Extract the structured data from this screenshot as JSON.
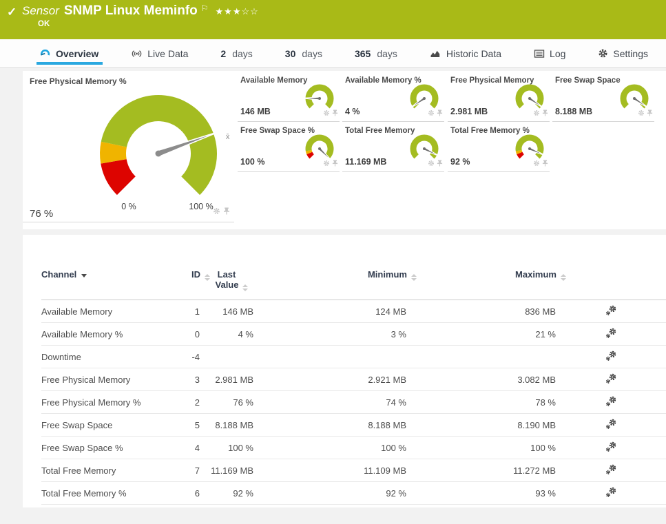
{
  "header": {
    "check_icon": "✓",
    "kind_label": "Sensor",
    "title": "SNMP Linux Meminfo",
    "flag_icon": "⚐",
    "stars_filled": "★★★",
    "stars_empty": "☆☆",
    "status": "OK",
    "bg_color": "#a9ba17"
  },
  "tabs": [
    {
      "label": "Overview",
      "icon": "gauge",
      "active": true
    },
    {
      "label": "Live Data",
      "icon": "live",
      "active": false
    },
    {
      "num": "2",
      "word": "days",
      "active": false
    },
    {
      "num": "30",
      "word": "days",
      "active": false
    },
    {
      "num": "365",
      "word": "days",
      "active": false
    },
    {
      "label": "Historic Data",
      "icon": "chart",
      "active": false
    },
    {
      "label": "Log",
      "icon": "log",
      "active": false
    },
    {
      "label": "Settings",
      "icon": "gear",
      "active": false
    }
  ],
  "gauges": {
    "main": {
      "title": "Free Physical Memory %",
      "value": "76 %",
      "min_label": "0 %",
      "max_label": "100 %",
      "needle_percent": 76,
      "avg_percent": 78,
      "avg_label": "x̄",
      "segments": [
        {
          "from": 0,
          "to": 13,
          "color": "#dd0400"
        },
        {
          "from": 13,
          "to": 21,
          "color": "#f0b400"
        },
        {
          "from": 21,
          "to": 100,
          "color": "#a4bc21"
        }
      ]
    },
    "segments_limits": [
      {
        "from": 0,
        "to": 8,
        "color": "#dd0400"
      },
      {
        "from": 8,
        "to": 13,
        "color": "#f0b400"
      },
      {
        "from": 13,
        "to": 100,
        "color": "#a4bc21"
      }
    ],
    "segments_plain": [
      {
        "from": 0,
        "to": 100,
        "color": "#a4bc21"
      }
    ],
    "minis": [
      {
        "title": "Available Memory",
        "value": "146 MB",
        "needle": 17,
        "limits": false
      },
      {
        "title": "Available Memory %",
        "value": "4 %",
        "needle": 4,
        "limits": false
      },
      {
        "title": "Free Physical Memory",
        "value": "2.981 MB",
        "needle": 96,
        "limits": false
      },
      {
        "title": "Free Swap Space",
        "value": "8.188 MB",
        "needle": 96,
        "limits": false
      },
      {
        "title": "Free Swap Space %",
        "value": "100 %",
        "needle": 100,
        "limits": true
      },
      {
        "title": "Total Free Memory",
        "value": "11.169 MB",
        "needle": 93,
        "limits": false
      },
      {
        "title": "Total Free Memory %",
        "value": "92 %",
        "needle": 92,
        "limits": true
      }
    ]
  },
  "table": {
    "columns": {
      "channel": "Channel",
      "id": "ID",
      "last_line1": "Last",
      "last_line2": "Value",
      "minimum": "Minimum",
      "maximum": "Maximum"
    },
    "rows": [
      {
        "channel": "Available Memory",
        "id": "1",
        "last": "146 MB",
        "min": "124 MB",
        "max": "836 MB"
      },
      {
        "channel": "Available Memory %",
        "id": "0",
        "last": "4 %",
        "min": "3 %",
        "max": "21 %"
      },
      {
        "channel": "Downtime",
        "id": "-4",
        "last": "",
        "min": "",
        "max": ""
      },
      {
        "channel": "Free Physical Memory",
        "id": "3",
        "last": "2.981 MB",
        "min": "2.921 MB",
        "max": "3.082 MB"
      },
      {
        "channel": "Free Physical Memory %",
        "id": "2",
        "last": "76 %",
        "min": "74 %",
        "max": "78 %"
      },
      {
        "channel": "Free Swap Space",
        "id": "5",
        "last": "8.188 MB",
        "min": "8.188 MB",
        "max": "8.190 MB"
      },
      {
        "channel": "Free Swap Space %",
        "id": "4",
        "last": "100 %",
        "min": "100 %",
        "max": "100 %"
      },
      {
        "channel": "Total Free Memory",
        "id": "7",
        "last": "11.169 MB",
        "min": "11.109 MB",
        "max": "11.272 MB"
      },
      {
        "channel": "Total Free Memory %",
        "id": "6",
        "last": "92 %",
        "min": "92 %",
        "max": "93 %"
      }
    ]
  },
  "colors": {
    "accent_blue": "#2aa8e0",
    "gauge_green": "#a4bc21",
    "gauge_yellow": "#f0b400",
    "gauge_red": "#dd0400",
    "needle_gray": "#8c8c8c"
  }
}
